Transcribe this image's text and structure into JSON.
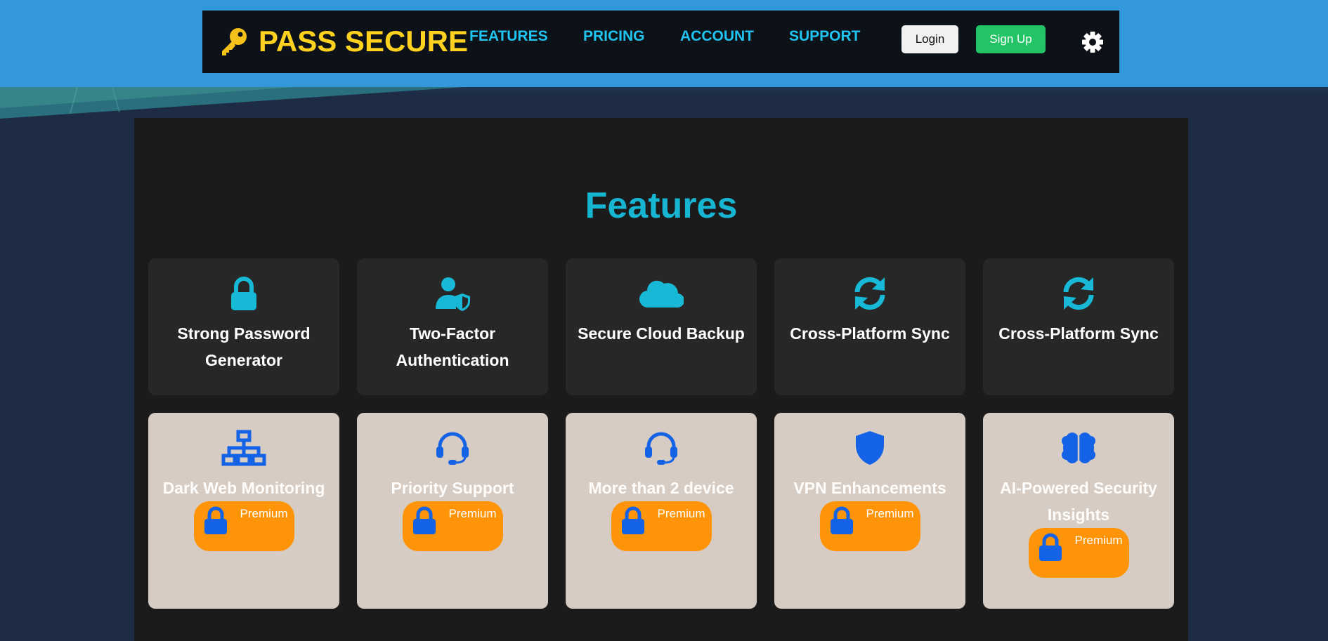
{
  "colors": {
    "top_band": "#3496db",
    "navbar_bg": "#0d1118",
    "brand_yellow": "#ffd21f",
    "nav_link": "#20c4f0",
    "feature_title": "#16b5d2",
    "feature_icon": "#17b9d6",
    "premium_icon": "#1463e6",
    "premium_badge": "#ff9408",
    "signup_green": "#23c466"
  },
  "header": {
    "logo_icon": "key-icon",
    "brand": "PASS SECURE",
    "nav": [
      {
        "label": "FEATURES"
      },
      {
        "label": "PRICING"
      },
      {
        "label": "ACCOUNT"
      },
      {
        "label": "SUPPORT"
      }
    ],
    "login_label": "Login",
    "signup_label": "Sign Up",
    "theme_icon": "gear-icon"
  },
  "features": {
    "title": "Features",
    "basic": [
      {
        "icon": "lock-icon",
        "title": "Strong Password Generator"
      },
      {
        "icon": "user-shield-icon",
        "title": "Two-Factor Authentication"
      },
      {
        "icon": "cloud-icon",
        "title": "Secure Cloud Backup"
      },
      {
        "icon": "sync-icon",
        "title": "Cross-Platform Sync"
      },
      {
        "icon": "sync-icon",
        "title": "Cross-Platform Sync"
      }
    ],
    "premium": [
      {
        "icon": "network-icon",
        "title": "Dark Web Monitoring",
        "badge": "Premium"
      },
      {
        "icon": "headset-icon",
        "title": "Priority Support",
        "badge": "Premium"
      },
      {
        "icon": "headset-icon",
        "title": "More than 2 device",
        "badge": "Premium"
      },
      {
        "icon": "shield-icon",
        "title": "VPN Enhancements",
        "badge": "Premium"
      },
      {
        "icon": "brain-icon",
        "title": "AI-Powered Security Insights",
        "badge": "Premium"
      }
    ]
  }
}
